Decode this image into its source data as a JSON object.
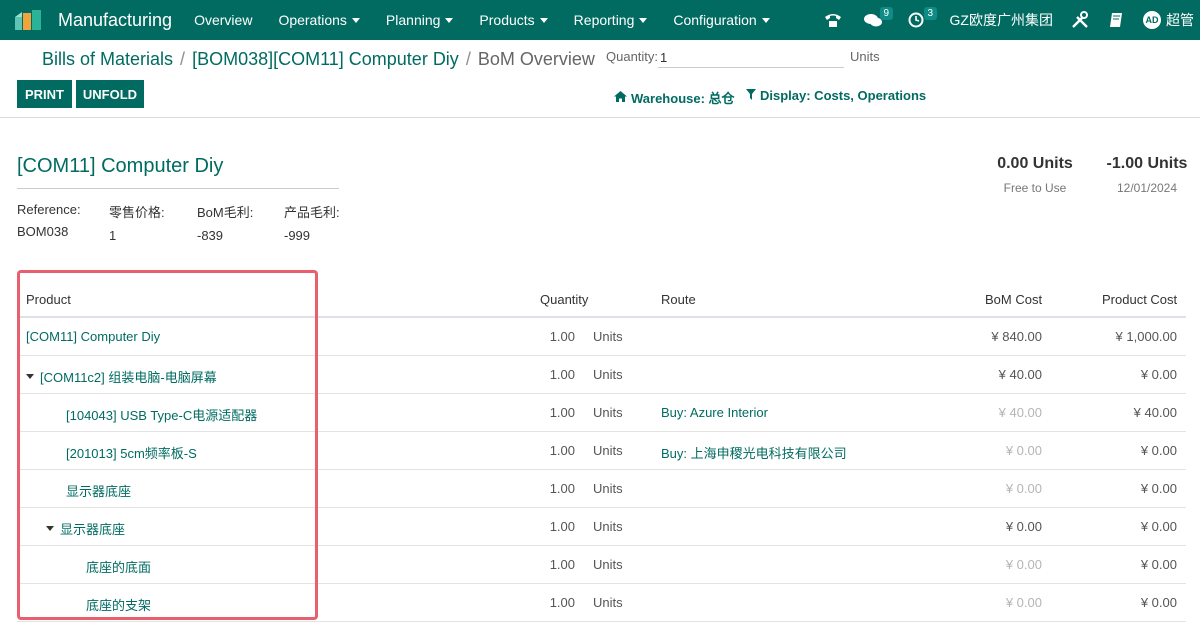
{
  "navbar": {
    "app_title": "Manufacturing",
    "menu": [
      "Overview",
      "Operations",
      "Planning",
      "Products",
      "Reporting",
      "Configuration"
    ],
    "messages_count": "9",
    "activities_count": "3",
    "company": "GZ欧度广州集团",
    "user_initials": "AD",
    "user_name": "超管"
  },
  "breadcrumb": {
    "root": "Bills of Materials",
    "record": "[BOM038][COM11] Computer Diy",
    "current": "BoM Overview"
  },
  "controls": {
    "quantity_label": "Quantity:",
    "quantity_value": "1",
    "quantity_unit": "Units",
    "print_label": "PRINT",
    "unfold_label": "UNFOLD",
    "warehouse_filter": "Warehouse: 总仓",
    "display_filter": "Display: Costs, Operations"
  },
  "report": {
    "title": "[COM11] Computer Diy",
    "meta": [
      {
        "key": "Reference:",
        "value": "BOM038"
      },
      {
        "key": "零售价格:",
        "value": "1"
      },
      {
        "key": "BoM毛利:",
        "value": "-839"
      },
      {
        "key": "产品毛利:",
        "value": "-999"
      }
    ],
    "free_to_use_value": "0.00 Units",
    "free_to_use_label": "Free to Use",
    "forecast_value": "-1.00 Units",
    "forecast_date": "12/01/2024"
  },
  "table": {
    "headers": {
      "product": "Product",
      "quantity": "Quantity",
      "route": "Route",
      "bom_cost": "BoM Cost",
      "product_cost": "Product Cost"
    },
    "rows": [
      {
        "product": "[COM11] Computer Diy",
        "level": 0,
        "foldable": false,
        "qty": "1.00",
        "unit": "Units",
        "route": "",
        "bom_cost": "¥ 840.00",
        "bom_muted": false,
        "product_cost": "¥ 1,000.00"
      },
      {
        "product": "[COM11c2] 组装电脑-电脑屏幕",
        "level": 0,
        "foldable": true,
        "qty": "1.00",
        "unit": "Units",
        "route": "",
        "bom_cost": "¥ 40.00",
        "bom_muted": false,
        "product_cost": "¥ 0.00"
      },
      {
        "product": "[104043] USB Type-C电源适配器",
        "level": 1,
        "foldable": false,
        "qty": "1.00",
        "unit": "Units",
        "route": "Buy: Azure Interior",
        "bom_cost": "¥ 40.00",
        "bom_muted": true,
        "product_cost": "¥ 40.00"
      },
      {
        "product": "[201013] 5cm频率板-S",
        "level": 1,
        "foldable": false,
        "qty": "1.00",
        "unit": "Units",
        "route": "Buy: 上海申稷光电科技有限公司",
        "bom_cost": "¥ 0.00",
        "bom_muted": true,
        "product_cost": "¥ 0.00"
      },
      {
        "product": "显示器底座",
        "level": 1,
        "foldable": false,
        "qty": "1.00",
        "unit": "Units",
        "route": "",
        "bom_cost": "¥ 0.00",
        "bom_muted": true,
        "product_cost": "¥ 0.00"
      },
      {
        "product": "显示器底座",
        "level": 1,
        "foldable": true,
        "qty": "1.00",
        "unit": "Units",
        "route": "",
        "bom_cost": "¥ 0.00",
        "bom_muted": false,
        "product_cost": "¥ 0.00"
      },
      {
        "product": "底座的底面",
        "level": 2,
        "foldable": false,
        "qty": "1.00",
        "unit": "Units",
        "route": "",
        "bom_cost": "¥ 0.00",
        "bom_muted": true,
        "product_cost": "¥ 0.00"
      },
      {
        "product": "底座的支架",
        "level": 2,
        "foldable": false,
        "qty": "1.00",
        "unit": "Units",
        "route": "",
        "bom_cost": "¥ 0.00",
        "bom_muted": true,
        "product_cost": "¥ 0.00"
      }
    ]
  }
}
